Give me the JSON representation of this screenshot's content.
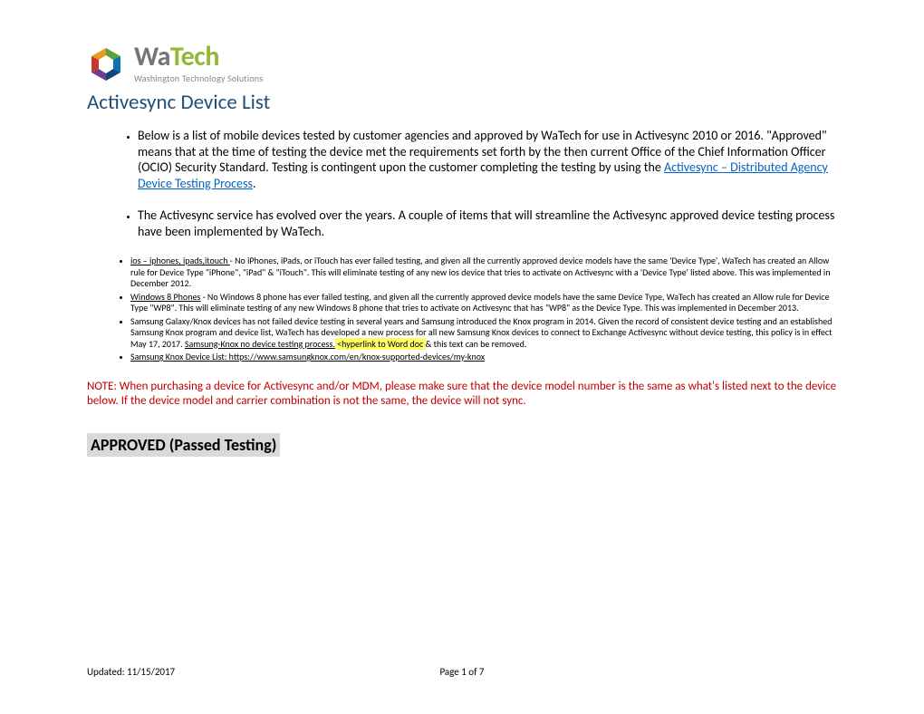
{
  "logo": {
    "wa": "Wa",
    "tech": "Tech",
    "sub": "Washington Technology Solutions"
  },
  "title": "Activesync Device List",
  "intro": {
    "para1_pre": "Below is a list of mobile devices tested by customer agencies and approved by WaTech for use in Activesync 2010 or 2016. \"Approved\" means that at the time of testing the device met the requirements set forth by the then current Office of the Chief Information Officer (OCIO) Security Standard.  Testing is contingent upon the customer completing the testing by using the ",
    "para1_link": "Activesync – Distributed Agency Device Testing Process",
    "para1_post": ".",
    "para2": "The Activesync service has evolved over the years.  A couple of items that will streamline the Activesync approved device testing process have been implemented by WaTech."
  },
  "sublist": {
    "ios_label": "ios – iphones, ipads,itouch ",
    "ios_text": "- No iPhones, iPads, or iTouch has ever failed testing, and given all the currently approved device models have the same 'Device Type', WaTech has created an Allow rule for Device Type \"iPhone\", \"iPad\" & \"iTouch\".  This will eliminate testing of any new ios device that tries to activate on Activesync with a 'Device Type' listed above.  This was implemented in December 2012.",
    "win_label": "Windows 8 Phones",
    "win_text": " - No Windows 8 phone has ever failed testing, and given all the currently approved device models have the same Device Type, WaTech has created an Allow rule for Device Type \"WP8\".  This will eliminate testing of any new Windows 8 phone that tries to activate on Activesync that has \"WP8\" as the Device Type.  This was implemented in December 2013.",
    "knox_pre": "Samsung Galaxy/Knox devices has not failed device testing in several years and Samsung introduced the Knox program in 2014.  Given the record of consistent device testing and an established Samsung Knox program and device list, WaTech has developed a new process for all new Samsung Knox devices to connect to Exchange Activesync without device testing, this policy is in effect May 17, 2017.  ",
    "knox_link": "Samsung-Knox no device testing process.",
    "knox_hl": "  <hyperlink to Word doc ",
    "knox_post": "& this text can be removed.",
    "knox_list_label": "Samsung Knox Device List:  ",
    "knox_list_url": "https://www.samsungknox.com/en/knox-supported-devices/my-knox"
  },
  "note": "NOTE: When purchasing a device for Activesync and/or MDM, please make sure that the device model number is the same as what's listed next to the device below.  If the device model and carrier combination is not the same, the device will not sync.",
  "approved_heading": "APPROVED (Passed Testing)",
  "footer": {
    "updated": "Updated: 11/15/2017",
    "page": "Page 1 of 7"
  }
}
